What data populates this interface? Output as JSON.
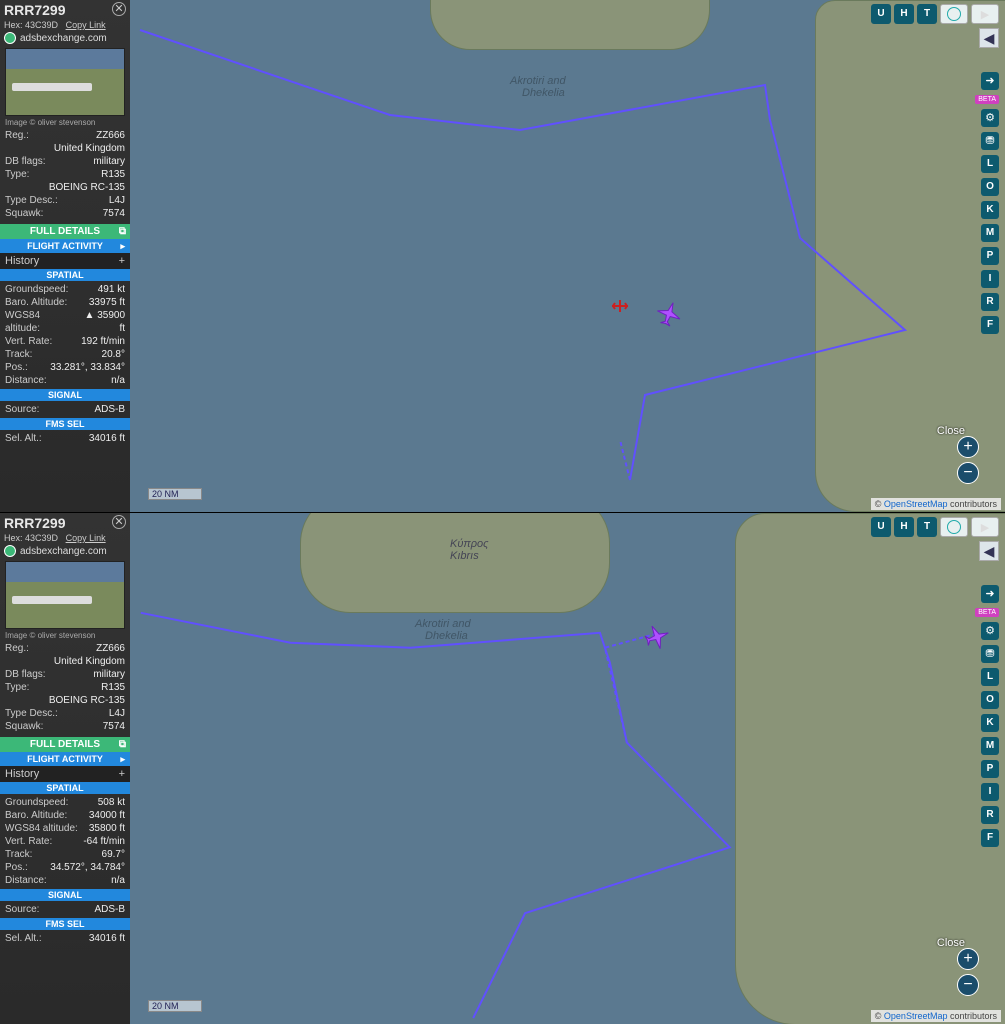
{
  "panels": [
    {
      "callsign": "RRR7299",
      "hex_label": "Hex:",
      "hex": "43C39D",
      "copy_link": "Copy Link",
      "site": "adsbexchange.com",
      "img_credit": "Image © oliver stevenson",
      "info": {
        "reg_label": "Reg.:",
        "reg": "ZZ666",
        "country": "United Kingdom",
        "dbflags_label": "DB flags:",
        "dbflags": "military",
        "type_label": "Type:",
        "type": "R135",
        "type_full": "BOEING RC-135",
        "typedesc_label": "Type Desc.:",
        "typedesc": "L4J",
        "squawk_label": "Squawk:",
        "squawk": "7574"
      },
      "buttons": {
        "full_details": "FULL DETAILS",
        "flight_activity": "FLIGHT ACTIVITY",
        "history": "History"
      },
      "spatial_hdr": "SPATIAL",
      "spatial": {
        "gs_label": "Groundspeed:",
        "gs": "491 kt",
        "balt_label": "Baro. Altitude:",
        "balt": "33975 ft",
        "wgs_label": "WGS84 altitude:",
        "wgs": "▲ 35900 ft",
        "vr_label": "Vert. Rate:",
        "vr": "192 ft/min",
        "trk_label": "Track:",
        "trk": "20.8°",
        "pos_label": "Pos.:",
        "pos": "33.281°, 33.834°",
        "dist_label": "Distance:",
        "dist": "n/a"
      },
      "signal_hdr": "SIGNAL",
      "signal": {
        "src_label": "Source:",
        "src": "ADS-B"
      },
      "fms_hdr": "FMS SEL",
      "fms": {
        "selalt_label": "Sel. Alt.:",
        "selalt": "34016 ft"
      },
      "map": {
        "scale": "20 NM",
        "close": "Close",
        "city1": "Akrotiri and",
        "city2": "Dhekelia",
        "attrib_pre": "© ",
        "attrib_link": "OpenStreetMap",
        "attrib_post": " contributors"
      }
    },
    {
      "callsign": "RRR7299",
      "hex_label": "Hex:",
      "hex": "43C39D",
      "copy_link": "Copy Link",
      "site": "adsbexchange.com",
      "img_credit": "Image © oliver stevenson",
      "info": {
        "reg_label": "Reg.:",
        "reg": "ZZ666",
        "country": "United Kingdom",
        "dbflags_label": "DB flags:",
        "dbflags": "military",
        "type_label": "Type:",
        "type": "R135",
        "type_full": "BOEING RC-135",
        "typedesc_label": "Type Desc.:",
        "typedesc": "L4J",
        "squawk_label": "Squawk:",
        "squawk": "7574"
      },
      "buttons": {
        "full_details": "FULL DETAILS",
        "flight_activity": "FLIGHT ACTIVITY",
        "history": "History"
      },
      "spatial_hdr": "SPATIAL",
      "spatial": {
        "gs_label": "Groundspeed:",
        "gs": "508 kt",
        "balt_label": "Baro. Altitude:",
        "balt": "34000 ft",
        "wgs_label": "WGS84 altitude:",
        "wgs": "35800 ft",
        "vr_label": "Vert. Rate:",
        "vr": "-64 ft/min",
        "trk_label": "Track:",
        "trk": "69.7°",
        "pos_label": "Pos.:",
        "pos": "34.572°, 34.784°",
        "dist_label": "Distance:",
        "dist": "n/a"
      },
      "signal_hdr": "SIGNAL",
      "signal": {
        "src_label": "Source:",
        "src": "ADS-B"
      },
      "fms_hdr": "FMS SEL",
      "fms": {
        "selalt_label": "Sel. Alt.:",
        "selalt": "34016 ft"
      },
      "map": {
        "scale": "20 NM",
        "close": "Close",
        "city1": "Akrotiri and",
        "city2": "Dhekelia",
        "city3": "Κύπρος",
        "city4": "Kıbrıs",
        "attrib_pre": "© ",
        "attrib_link": "OpenStreetMap",
        "attrib_post": " contributors"
      }
    }
  ],
  "controls": {
    "U": "U",
    "H": "H",
    "T": "T",
    "beta": "BETA",
    "L": "L",
    "O": "O",
    "K": "K",
    "M": "M",
    "P": "P",
    "I": "I",
    "R": "R",
    "F": "F"
  }
}
